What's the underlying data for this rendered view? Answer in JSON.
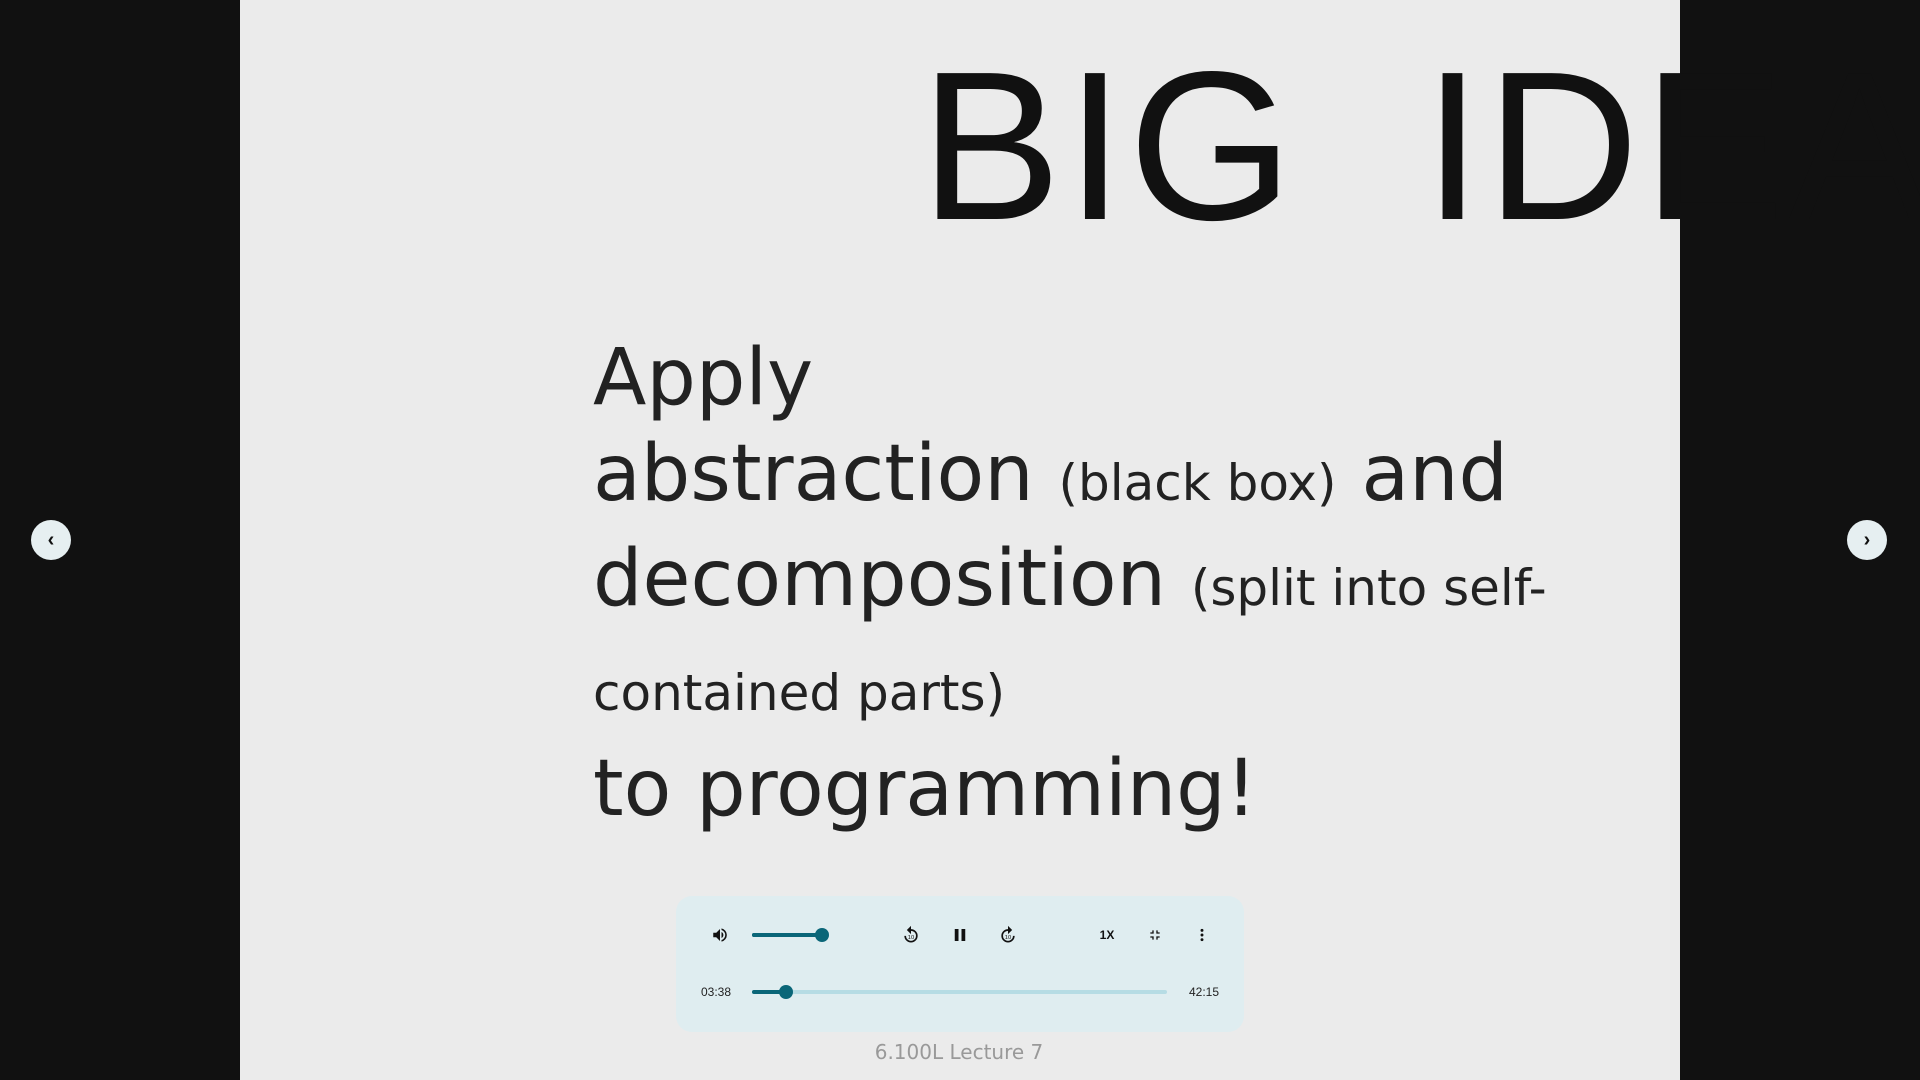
{
  "slide": {
    "title": "BIG  IDEA",
    "lines": [
      {
        "main": "Apply",
        "note": ""
      },
      {
        "main": "abstraction",
        "note": "(black box)",
        "tail": "and"
      },
      {
        "main": "decomposition",
        "note": "(split into self-contained parts)"
      },
      {
        "main": "to programming!",
        "note": ""
      }
    ]
  },
  "nav": {
    "prev_icon": "chevron-left-icon",
    "next_icon": "chevron-right-icon",
    "prev": "‹",
    "next": "›"
  },
  "player": {
    "accent": "#0a6678",
    "volume_percent": 100,
    "progress_percent": 8.2,
    "current_time": "03:38",
    "duration": "42:15",
    "speed": "1X",
    "label": "6.100L Lecture 7"
  }
}
